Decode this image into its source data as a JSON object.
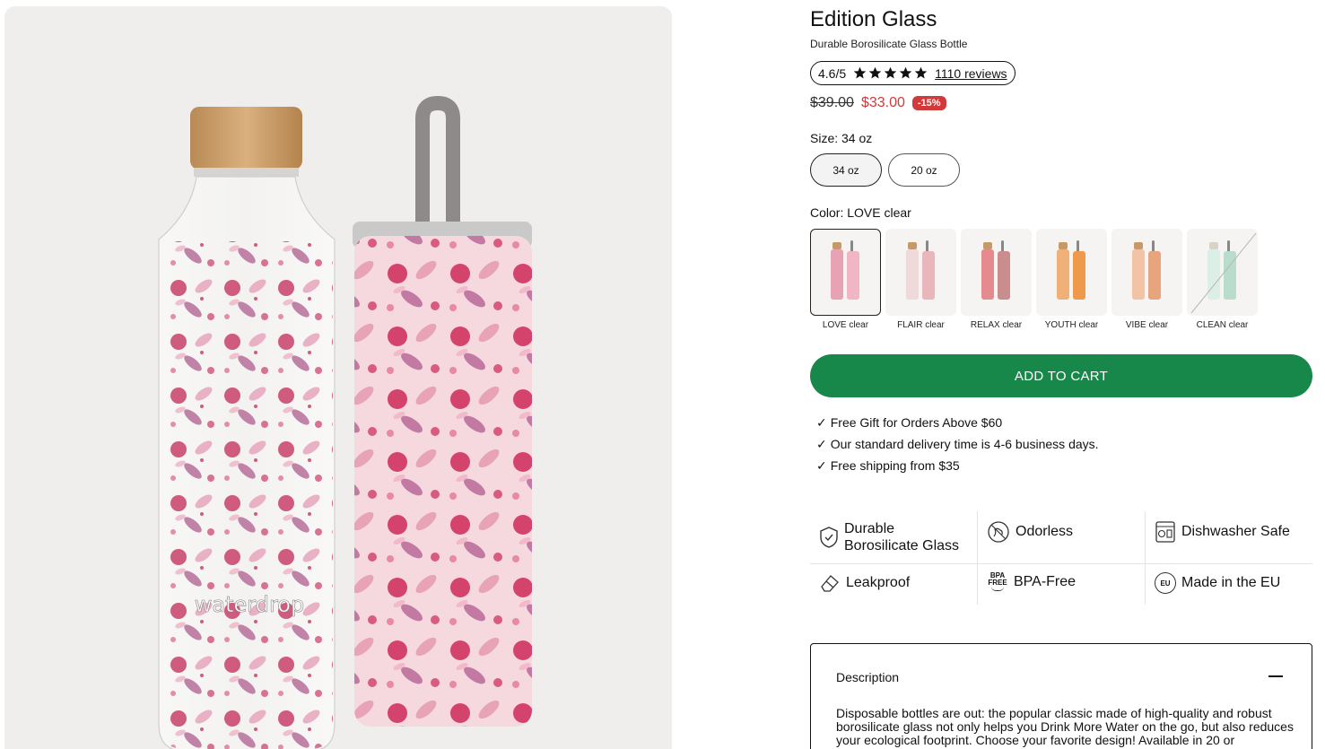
{
  "product": {
    "title": "Edition Glass",
    "subtitle": "Durable Borosilicate Glass Bottle",
    "brand_mark": "waterdrop"
  },
  "rating": {
    "score": "4.6/5",
    "stars": 5,
    "reviews": "1110 reviews"
  },
  "price": {
    "old": "$39.00",
    "new": "$33.00",
    "discount": "-15%"
  },
  "size": {
    "label": "Size:",
    "selected": "34 oz",
    "options": [
      "34 oz",
      "20 oz"
    ]
  },
  "color": {
    "label": "Color:",
    "selected": "LOVE clear",
    "options": [
      "LOVE clear",
      "FLAIR clear",
      "RELAX clear",
      "YOUTH clear",
      "VIBE clear",
      "CLEAN clear"
    ],
    "swatch_colors": [
      "#e7a2b4",
      "#e9b7bb",
      "#d9666e",
      "#ef9a4b",
      "#e7a47d",
      "#b9ddcd"
    ]
  },
  "cart": {
    "button": "ADD TO CART",
    "accent": "#17884a"
  },
  "perks": [
    "Free Gift for Orders Above $60",
    "Our standard delivery time is 4-6 business days.",
    "Free shipping from $35"
  ],
  "features": [
    {
      "icon": "shield-check-icon",
      "label_1": "Durable",
      "label_2": "Borosilicate Glass"
    },
    {
      "icon": "no-smell-icon",
      "label": "Odorless"
    },
    {
      "icon": "dishwasher-icon",
      "label": "Dishwasher Safe"
    },
    {
      "icon": "eraser-icon",
      "label": "Leakproof"
    },
    {
      "icon": "bpa-free-icon",
      "label": "BPA-Free",
      "icon_text_1": "BPA",
      "icon_text_2": "FREE"
    },
    {
      "icon": "eu-icon",
      "label": "Made in the EU",
      "icon_text": "EU"
    }
  ],
  "description": {
    "title": "Description",
    "text": "Disposable bottles are out: the popular classic made of high-quality and robust borosilicate glass not only helps you Drink More Water on the go, but also reduces your ecological footprint. Choose your favorite design! Available in 20 or"
  },
  "colors": {
    "sale": "#d2393a",
    "pink_pattern": "#e89bb0"
  }
}
